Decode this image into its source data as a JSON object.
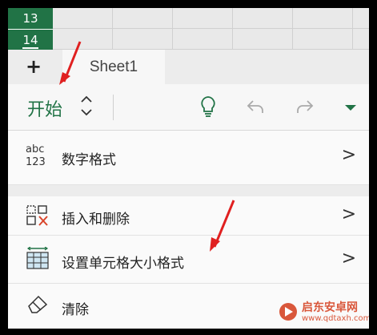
{
  "grid": {
    "rows": [
      "13",
      "14"
    ]
  },
  "tabs": {
    "add_label": "+",
    "sheet_label": "Sheet1"
  },
  "ribbon": {
    "title": "开始",
    "updown_label": "⌃⌄",
    "icons": [
      "lightbulb-icon",
      "undo-icon",
      "redo-icon",
      "dropdown-icon"
    ]
  },
  "menu": {
    "items": [
      {
        "icon": "number-format-icon",
        "icon_text_top": "abc",
        "icon_text_bottom": "123",
        "label": "数字格式",
        "chevron": ">"
      },
      {
        "icon": "insert-delete-icon",
        "label": "插入和删除",
        "chevron": ">"
      },
      {
        "icon": "cell-size-icon",
        "label": "设置单元格大小格式",
        "chevron": ">"
      },
      {
        "icon": "eraser-icon",
        "label": "清除",
        "chevron": ""
      }
    ]
  },
  "watermark": {
    "title": "启东安卓网",
    "url": "www.qdtaxh.com"
  },
  "colors": {
    "accent": "#217346",
    "arrow": "#e02020",
    "watermark": "#d9573b"
  }
}
